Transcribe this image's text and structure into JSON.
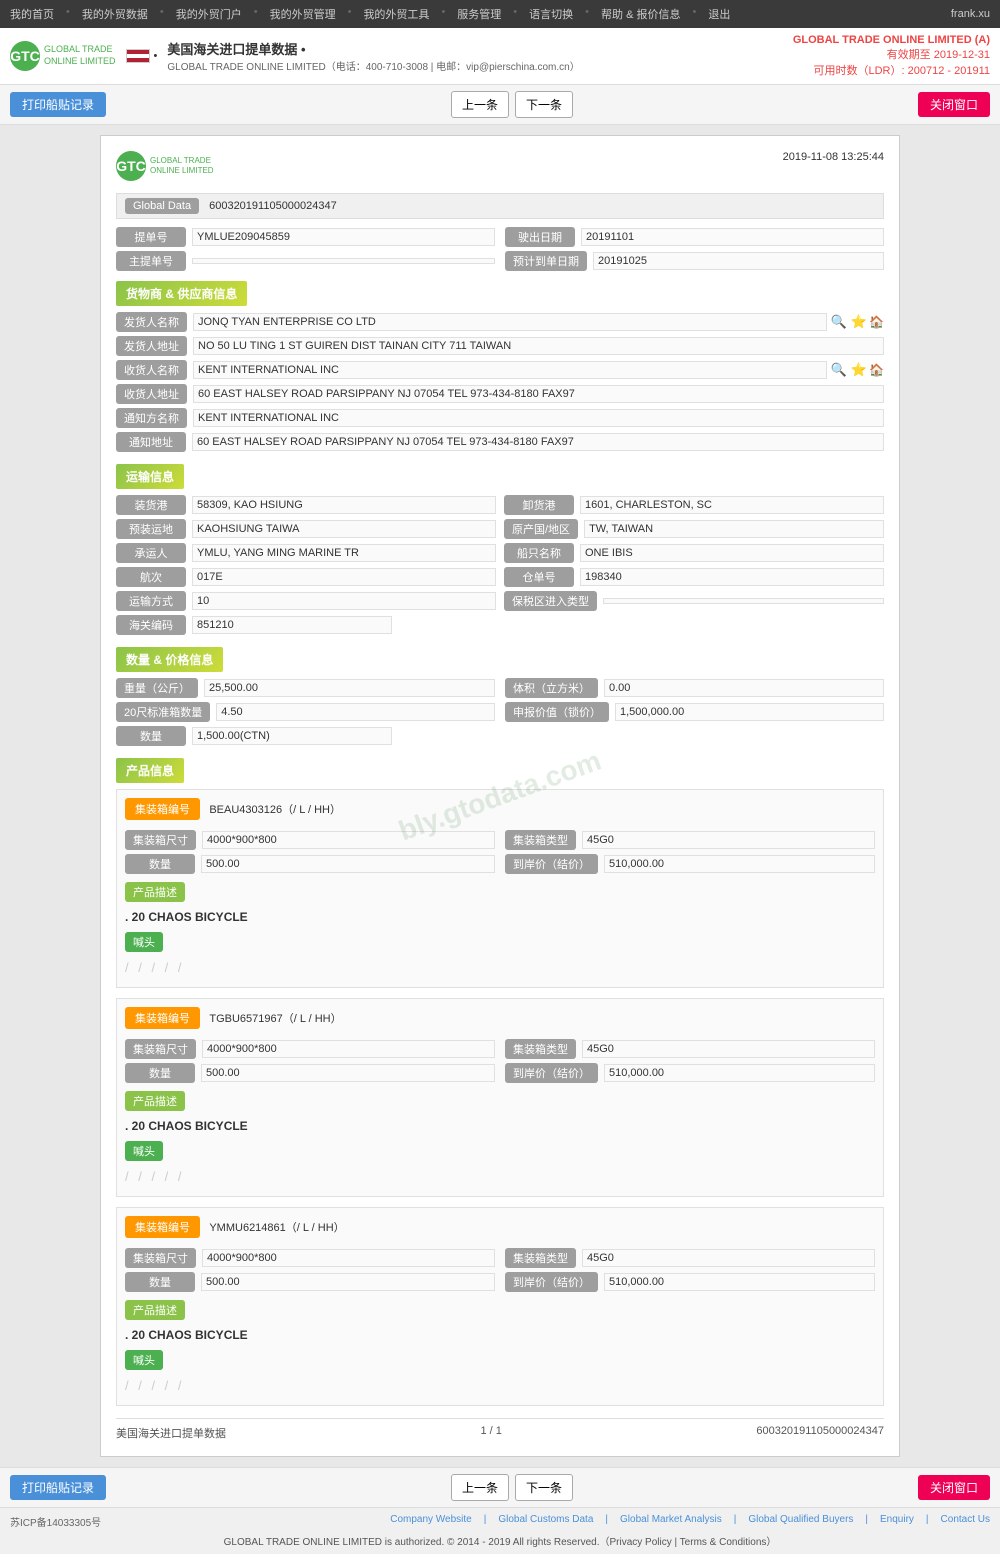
{
  "topnav": {
    "items": [
      "我的首页",
      "我的外贸数据",
      "我的外贸门户",
      "我的外贸管理",
      "我的外贸工具",
      "服务管理",
      "语言切换",
      "帮助 & 报价信息",
      "退出"
    ],
    "user": "frank.xu"
  },
  "header": {
    "title": "美国海关进口提单数据 •",
    "subtitle": "GLOBAL TRADE ONLINE LIMITED（电话：400-710-3008 | 电邮：vip@pierschina.com.cn）",
    "company": "GLOBAL TRADE ONLINE LIMITED (A)",
    "valid_until": "有效期至 2019-12-31",
    "ldr": "可用时数（LDR）: 200712 - 201911"
  },
  "toolbar": {
    "print_label": "打印船贴记录",
    "prev_label": "上一条",
    "next_label": "下一条",
    "close_label": "关闭窗口"
  },
  "document": {
    "datetime": "2019-11-08 13:25:44",
    "global_data": {
      "label": "Global Data",
      "value": "600320191105000024347"
    },
    "bill_no": {
      "label": "提单号",
      "value": "YMLUE209045859"
    },
    "sail_date": {
      "label": "驶出日期",
      "value": "20191101"
    },
    "master_bill": {
      "label": "主提单号",
      "value": ""
    },
    "estimated_date": {
      "label": "预计到单日期",
      "value": "20191025"
    },
    "sections": {
      "shipper": "货物商 & 供应商信息",
      "transport": "运输信息",
      "numbers": "数量 & 价格信息",
      "products": "产品信息"
    },
    "shipper_info": {
      "shipper_name_label": "发货人名称",
      "shipper_name_value": "JONQ TYAN ENTERPRISE CO LTD",
      "shipper_addr_label": "发货人地址",
      "shipper_addr_value": "NO 50 LU TING 1 ST GUIREN DIST TAINAN CITY 711 TAIWAN",
      "consignee_name_label": "收货人名称",
      "consignee_name_value": "KENT INTERNATIONAL INC",
      "consignee_addr_label": "收货人地址",
      "consignee_addr_value": "60 EAST HALSEY ROAD PARSIPPANY NJ 07054 TEL 973-434-8180 FAX97",
      "notify_name_label": "通知方名称",
      "notify_name_value": "KENT INTERNATIONAL INC",
      "notify_addr_label": "通知地址",
      "notify_addr_value": "60 EAST HALSEY ROAD PARSIPPANY NJ 07054 TEL 973-434-8180 FAX97"
    },
    "transport_info": {
      "loading_port_label": "装货港",
      "loading_port_value": "58309, KAO HSIUNG",
      "discharge_port_label": "卸货港",
      "discharge_port_value": "1601, CHARLESTON, SC",
      "loading_addr_label": "预装运地",
      "loading_addr_value": "KAOHSIUNG TAIWA",
      "origin_label": "原产国/地区",
      "origin_value": "TW, TAIWAN",
      "carrier_label": "承运人",
      "carrier_value": "YMLU, YANG MING MARINE TR",
      "vessel_label": "船只名称",
      "vessel_value": "ONE IBIS",
      "voyage_label": "航次",
      "voyage_value": "017E",
      "inbond_label": "仓单号",
      "inbond_value": "198340",
      "transport_mode_label": "运输方式",
      "transport_mode_value": "10",
      "bonded_label": "保税区进入类型",
      "bonded_value": "",
      "customs_code_label": "海关编码",
      "customs_code_value": "851210"
    },
    "numbers_info": {
      "weight_label": "重量（公斤）",
      "weight_value": "25,500.00",
      "volume_label": "体积（立方米）",
      "volume_value": "0.00",
      "container_20_label": "20尺标准箱数量",
      "container_20_value": "4.50",
      "declared_value_label": "申报价值（锁价）",
      "declared_value_value": "1,500,000.00",
      "quantity_label": "数量",
      "quantity_value": "1,500.00(CTN)"
    },
    "products": [
      {
        "container_no_label": "集装箱编号",
        "container_no": "BEAU4303126（/ L / HH）",
        "size_label": "集装箱尺寸",
        "size_value": "4000*900*800",
        "type_label": "集装箱类型",
        "type_value": "45G0",
        "qty_label": "数量",
        "qty_value": "500.00",
        "price_label": "到岸价（结价）",
        "price_value": "510,000.00",
        "desc_label": "产品描述",
        "desc_value": ". 20 CHAOS BICYCLE",
        "head_label": "喊头",
        "stars": "/ / / / /"
      },
      {
        "container_no_label": "集装箱编号",
        "container_no": "TGBU6571967（/ L / HH）",
        "size_label": "集装箱尺寸",
        "size_value": "4000*900*800",
        "type_label": "集装箱类型",
        "type_value": "45G0",
        "qty_label": "数量",
        "qty_value": "500.00",
        "price_label": "到岸价（结价）",
        "price_value": "510,000.00",
        "desc_label": "产品描述",
        "desc_value": ". 20 CHAOS BICYCLE",
        "head_label": "喊头",
        "stars": "/ / / / /"
      },
      {
        "container_no_label": "集装箱编号",
        "container_no": "YMMU6214861（/ L / HH）",
        "size_label": "集装箱尺寸",
        "size_value": "4000*900*800",
        "type_label": "集装箱类型",
        "type_value": "45G0",
        "qty_label": "数量",
        "qty_value": "500.00",
        "price_label": "到岸价（结价）",
        "price_value": "510,000.00",
        "desc_label": "产品描述",
        "desc_value": ". 20 CHAOS BICYCLE",
        "head_label": "喊头",
        "stars": "/ / / / /"
      }
    ],
    "doc_footer": {
      "source": "美国海关进口提单数据",
      "page": "1 / 1",
      "doc_no": "600320191105000024347"
    }
  },
  "bottom_footer": {
    "links": [
      "Company Website",
      "Global Customs Data",
      "Global Market Analysis",
      "Global Qualified Buyers",
      "Enquiry",
      "Contact Us"
    ],
    "copyright": "GLOBAL TRADE ONLINE LIMITED is authorized. © 2014 - 2019 All rights Reserved.（Privacy Policy | Terms & Conditions）",
    "icp": "苏ICP备14033305号"
  }
}
